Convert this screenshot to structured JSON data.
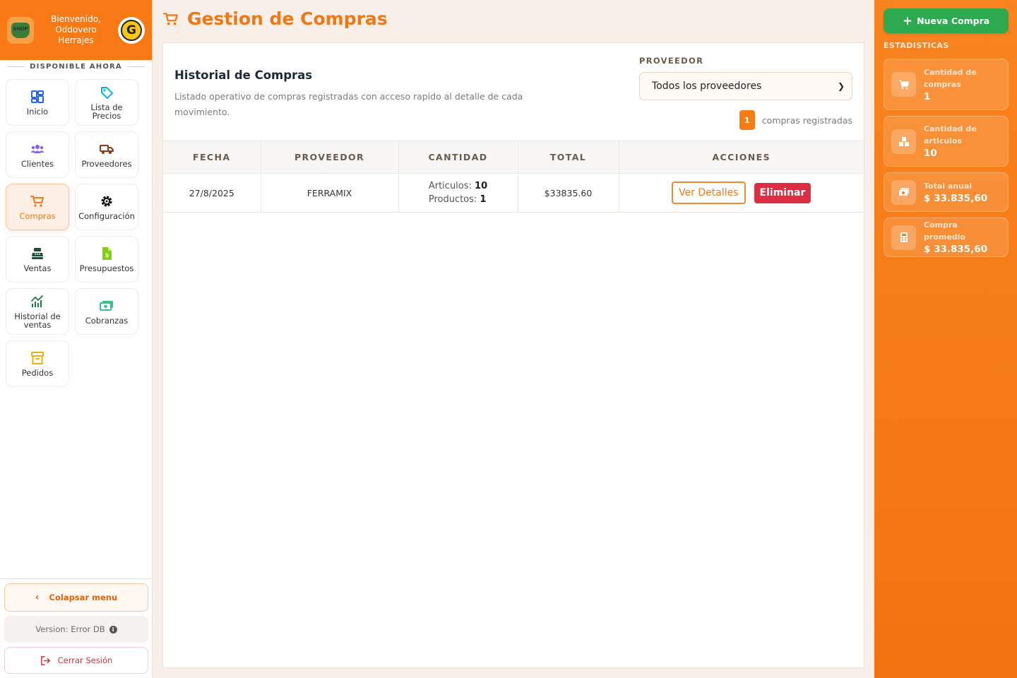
{
  "sidebar": {
    "welcome": "Bienvenido, Oddovero Herrajes",
    "shop_logo_text": "SHOP",
    "brand_logo_letter": "G",
    "section_label": "DISPONIBLE AHORA",
    "items": [
      {
        "label": "Inicio",
        "icon": "dashboard-icon",
        "color": "#2563eb"
      },
      {
        "label": "Lista de Precios",
        "icon": "tag-icon",
        "color": "#06b6d4"
      },
      {
        "label": "Clientes",
        "icon": "users-icon",
        "color": "#8b5cf6"
      },
      {
        "label": "Proveedores",
        "icon": "truck-icon",
        "color": "#8b3a12"
      },
      {
        "label": "Compras",
        "icon": "cart-icon",
        "color": "#f07a16",
        "active": true
      },
      {
        "label": "Configuración",
        "icon": "gear-icon",
        "color": "#111111"
      },
      {
        "label": "Ventas",
        "icon": "cash-register-icon",
        "color": "#1f4d3a"
      },
      {
        "label": "Presupuestos",
        "icon": "invoice-icon",
        "color": "#84cc16"
      },
      {
        "label": "Historial de ventas",
        "icon": "chart-icon",
        "color": "#15803d"
      },
      {
        "label": "Cobranzas",
        "icon": "money-icon",
        "color": "#34c28a"
      },
      {
        "label": "Pedidos",
        "icon": "box-icon",
        "color": "#eab308"
      }
    ],
    "collapse_label": "Colapsar menu",
    "version_label": "Version: Error DB",
    "logout_label": "Cerrar Sesión"
  },
  "main": {
    "title": "Gestion de Compras",
    "card_title": "Historial de Compras",
    "card_description": "Listado operativo de compras registradas con acceso rapido al detalle de cada movimiento.",
    "filter_label": "PROVEEDOR",
    "filter_selected": "Todos los proveedores",
    "count": "1",
    "count_text": "compras registradas",
    "table": {
      "headers": [
        "FECHA",
        "PROVEEDOR",
        "CANTIDAD",
        "TOTAL",
        "ACCIONES"
      ],
      "rows": [
        {
          "fecha": "27/8/2025",
          "proveedor": "FERRAMIX",
          "articulos_label": "Articulos:",
          "articulos": "10",
          "productos_label": "Productos:",
          "productos": "1",
          "total": "$33835.60",
          "detail_label": "Ver Detalles",
          "delete_label": "Eliminar"
        }
      ]
    }
  },
  "right_panel": {
    "new_button": "Nueva Compra",
    "stats_title": "ESTADISTICAS",
    "stats": [
      {
        "label": "Cantidad de compras",
        "value": "1",
        "icon": "cart-icon"
      },
      {
        "label": "Cantidad de articulos",
        "value": "10",
        "icon": "boxes-icon"
      },
      {
        "label": "Total anual",
        "value": "$ 33.835,60",
        "icon": "money-icon"
      },
      {
        "label": "Compra promedio",
        "value": "$ 33.835,60",
        "icon": "calculator-icon"
      }
    ]
  },
  "colors": {
    "brand_orange": "#f97a14",
    "success_green": "#2daa4f",
    "danger_red": "#dc2f43"
  }
}
